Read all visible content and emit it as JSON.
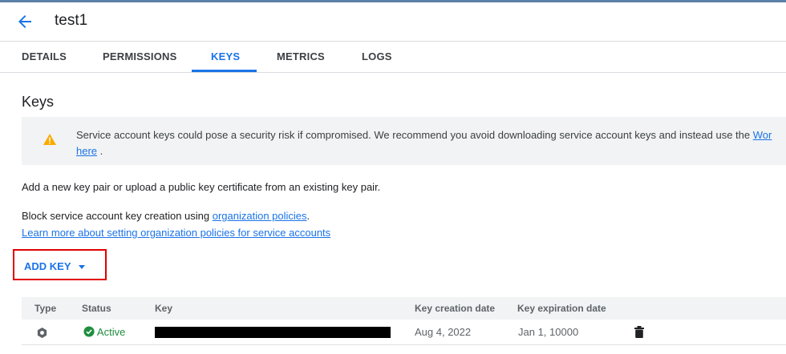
{
  "header": {
    "title": "test1"
  },
  "tabs": [
    {
      "label": "DETAILS"
    },
    {
      "label": "PERMISSIONS"
    },
    {
      "label": "KEYS"
    },
    {
      "label": "METRICS"
    },
    {
      "label": "LOGS"
    }
  ],
  "active_tab": "KEYS",
  "keys": {
    "heading": "Keys",
    "warning": {
      "text": "Service account keys could pose a security risk if compromised. We recommend you avoid downloading service account keys and instead use the ",
      "link_start": "Wor",
      "link_end": "here",
      "suffix": " ."
    },
    "intro": "Add a new key pair or upload a public key certificate from an existing key pair.",
    "block_text": "Block service account key creation using ",
    "block_link": "organization policies",
    "block_suffix": ".",
    "learn_more_link": "Learn more about setting organization policies for service accounts",
    "add_key_label": "ADD KEY",
    "highlight_color": "#e00000",
    "accent_color": "#1a73e8"
  },
  "table": {
    "headers": {
      "type": "Type",
      "status": "Status",
      "key": "Key",
      "created": "Key creation date",
      "expires": "Key expiration date"
    },
    "rows": [
      {
        "type_icon": "key-type-icon",
        "status": "Active",
        "status_color": "#1e8e3e",
        "created": "Aug 4, 2022",
        "expires": "Jan 1, 10000",
        "action_icon": "delete-icon"
      }
    ]
  }
}
